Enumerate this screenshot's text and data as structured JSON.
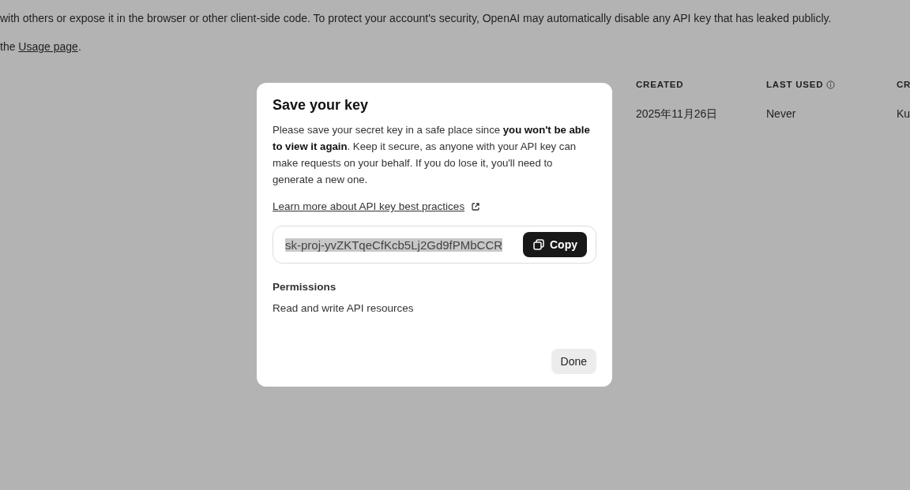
{
  "background": {
    "notice": "with others or expose it in the browser or other client-side code. To protect your account's security, OpenAI may automatically disable any API key that has leaked publicly.",
    "usage_prefix": "the",
    "usage_link": "Usage page",
    "usage_suffix": ".",
    "table": {
      "columns": [
        {
          "label": "CREATED"
        },
        {
          "label": "LAST USED",
          "info": true
        },
        {
          "label": "CR"
        }
      ],
      "rows": [
        [
          "2025年11月26日",
          "Never",
          "Ku"
        ]
      ]
    }
  },
  "modal": {
    "title": "Save your key",
    "body": "Please save your secret key in a safe place since **you won't be able to view it again**. Keep it secure, as anyone with your API key can make requests on your behalf. If you do lose it, you'll need to generate a new one.",
    "learn_link": "Learn more about API key best practices",
    "key": {
      "value": "sk-proj-yvZKTqeCfKcb5Lj2Gd9fPMbCCR",
      "highlighted": true
    },
    "copy_button": "Copy",
    "permissions_heading": "Permissions",
    "permissions_value": "Read and write API resources",
    "done_button": "Done"
  }
}
